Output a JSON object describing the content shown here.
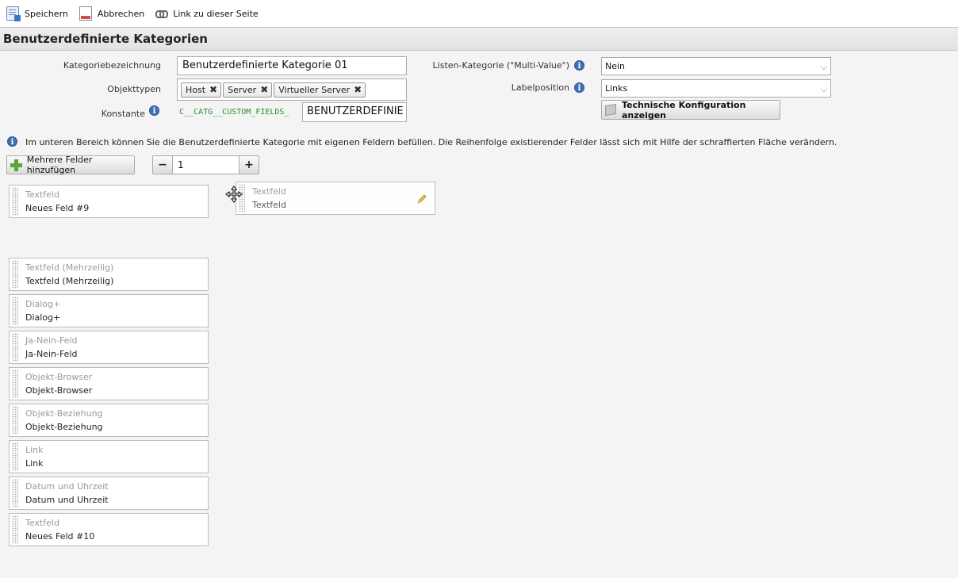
{
  "toolbar": {
    "save_label": "Speichern",
    "cancel_label": "Abbrechen",
    "link_label": "Link zu dieser Seite"
  },
  "page": {
    "title": "Benutzerdefinierte Kategorien"
  },
  "form": {
    "category_label": "Kategoriebezeichnung",
    "category_value": "Benutzerdefinierte Kategorie 01",
    "objecttypes_label": "Objekttypen",
    "objecttypes": [
      "Host",
      "Server",
      "Virtueller Server"
    ],
    "constant_label": "Konstante",
    "constant_prefix": "C__CATG__CUSTOM_FIELDS_",
    "constant_value": "BENUTZERDEFINIE",
    "list_category_label": "Listen-Kategorie (\"Multi-Value\")",
    "list_category_value": "Nein",
    "label_position_label": "Labelposition",
    "label_position_value": "Links",
    "tech_config_label": "Technische Konfiguration anzeigen"
  },
  "info_text": "Im unteren Bereich können Sie die Benutzerdefinierte Kategorie mit eigenen Feldern befüllen. Die Reihenfolge existierender Felder lässt sich mit Hilfe der schraffierten Fläche verändern.",
  "add_fields": {
    "label": "Mehrere Felder hinzufügen",
    "minus": "−",
    "count": "1",
    "plus": "+"
  },
  "fields": [
    {
      "type": "Textfeld",
      "name": "Neues Feld #9"
    },
    {
      "type": "Textfeld (Mehrzeilig)",
      "name": "Textfeld (Mehrzeilig)"
    },
    {
      "type": "Dialog+",
      "name": "Dialog+"
    },
    {
      "type": "Ja-Nein-Feld",
      "name": "Ja-Nein-Feld"
    },
    {
      "type": "Objekt-Browser",
      "name": "Objekt-Browser"
    },
    {
      "type": "Objekt-Beziehung",
      "name": "Objekt-Beziehung"
    },
    {
      "type": "Link",
      "name": "Link"
    },
    {
      "type": "Datum und Uhrzeit",
      "name": "Datum und Uhrzeit"
    },
    {
      "type": "Textfeld",
      "name": "Neues Feld #10"
    }
  ],
  "dragged_field": {
    "type": "Textfeld",
    "name": "Textfeld"
  },
  "colors": {
    "constant_prefix": "#2e8b2e",
    "info_icon": "#3f6fb4",
    "add_icon": "#5aa43a"
  }
}
